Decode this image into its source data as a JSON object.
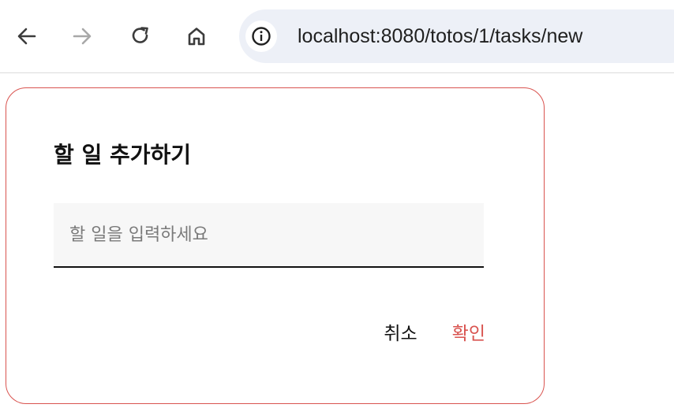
{
  "browser": {
    "url": "localhost:8080/totos/1/tasks/new",
    "icons": {
      "back": "arrow-left-icon",
      "forward": "arrow-right-icon",
      "reload": "reload-icon",
      "home": "home-icon",
      "site_info": "info-icon"
    }
  },
  "dialog": {
    "title": "할 일 추가하기",
    "input": {
      "placeholder": "할 일을 입력하세요",
      "value": ""
    },
    "cancel_label": "취소",
    "confirm_label": "확인"
  },
  "colors": {
    "accent": "#d9534f",
    "input_background": "#f7f7f7",
    "omnibox_background": "#edf0f7"
  }
}
